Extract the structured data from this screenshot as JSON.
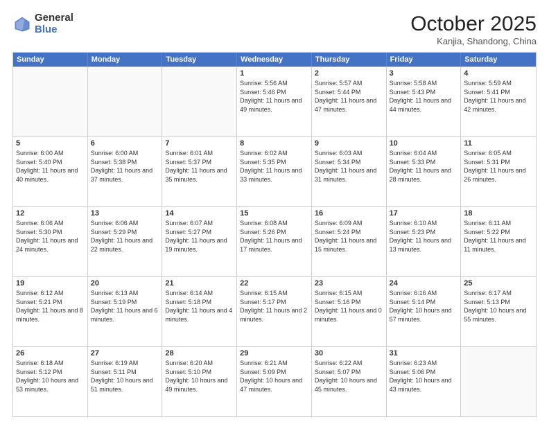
{
  "header": {
    "logo_general": "General",
    "logo_blue": "Blue",
    "title": "October 2025",
    "location": "Kanjia, Shandong, China"
  },
  "weekdays": [
    "Sunday",
    "Monday",
    "Tuesday",
    "Wednesday",
    "Thursday",
    "Friday",
    "Saturday"
  ],
  "rows": [
    [
      {
        "day": "",
        "text": ""
      },
      {
        "day": "",
        "text": ""
      },
      {
        "day": "",
        "text": ""
      },
      {
        "day": "1",
        "text": "Sunrise: 5:56 AM\nSunset: 5:46 PM\nDaylight: 11 hours and 49 minutes."
      },
      {
        "day": "2",
        "text": "Sunrise: 5:57 AM\nSunset: 5:44 PM\nDaylight: 11 hours and 47 minutes."
      },
      {
        "day": "3",
        "text": "Sunrise: 5:58 AM\nSunset: 5:43 PM\nDaylight: 11 hours and 44 minutes."
      },
      {
        "day": "4",
        "text": "Sunrise: 5:59 AM\nSunset: 5:41 PM\nDaylight: 11 hours and 42 minutes."
      }
    ],
    [
      {
        "day": "5",
        "text": "Sunrise: 6:00 AM\nSunset: 5:40 PM\nDaylight: 11 hours and 40 minutes."
      },
      {
        "day": "6",
        "text": "Sunrise: 6:00 AM\nSunset: 5:38 PM\nDaylight: 11 hours and 37 minutes."
      },
      {
        "day": "7",
        "text": "Sunrise: 6:01 AM\nSunset: 5:37 PM\nDaylight: 11 hours and 35 minutes."
      },
      {
        "day": "8",
        "text": "Sunrise: 6:02 AM\nSunset: 5:35 PM\nDaylight: 11 hours and 33 minutes."
      },
      {
        "day": "9",
        "text": "Sunrise: 6:03 AM\nSunset: 5:34 PM\nDaylight: 11 hours and 31 minutes."
      },
      {
        "day": "10",
        "text": "Sunrise: 6:04 AM\nSunset: 5:33 PM\nDaylight: 11 hours and 28 minutes."
      },
      {
        "day": "11",
        "text": "Sunrise: 6:05 AM\nSunset: 5:31 PM\nDaylight: 11 hours and 26 minutes."
      }
    ],
    [
      {
        "day": "12",
        "text": "Sunrise: 6:06 AM\nSunset: 5:30 PM\nDaylight: 11 hours and 24 minutes."
      },
      {
        "day": "13",
        "text": "Sunrise: 6:06 AM\nSunset: 5:29 PM\nDaylight: 11 hours and 22 minutes."
      },
      {
        "day": "14",
        "text": "Sunrise: 6:07 AM\nSunset: 5:27 PM\nDaylight: 11 hours and 19 minutes."
      },
      {
        "day": "15",
        "text": "Sunrise: 6:08 AM\nSunset: 5:26 PM\nDaylight: 11 hours and 17 minutes."
      },
      {
        "day": "16",
        "text": "Sunrise: 6:09 AM\nSunset: 5:24 PM\nDaylight: 11 hours and 15 minutes."
      },
      {
        "day": "17",
        "text": "Sunrise: 6:10 AM\nSunset: 5:23 PM\nDaylight: 11 hours and 13 minutes."
      },
      {
        "day": "18",
        "text": "Sunrise: 6:11 AM\nSunset: 5:22 PM\nDaylight: 11 hours and 11 minutes."
      }
    ],
    [
      {
        "day": "19",
        "text": "Sunrise: 6:12 AM\nSunset: 5:21 PM\nDaylight: 11 hours and 8 minutes."
      },
      {
        "day": "20",
        "text": "Sunrise: 6:13 AM\nSunset: 5:19 PM\nDaylight: 11 hours and 6 minutes."
      },
      {
        "day": "21",
        "text": "Sunrise: 6:14 AM\nSunset: 5:18 PM\nDaylight: 11 hours and 4 minutes."
      },
      {
        "day": "22",
        "text": "Sunrise: 6:15 AM\nSunset: 5:17 PM\nDaylight: 11 hours and 2 minutes."
      },
      {
        "day": "23",
        "text": "Sunrise: 6:15 AM\nSunset: 5:16 PM\nDaylight: 11 hours and 0 minutes."
      },
      {
        "day": "24",
        "text": "Sunrise: 6:16 AM\nSunset: 5:14 PM\nDaylight: 10 hours and 57 minutes."
      },
      {
        "day": "25",
        "text": "Sunrise: 6:17 AM\nSunset: 5:13 PM\nDaylight: 10 hours and 55 minutes."
      }
    ],
    [
      {
        "day": "26",
        "text": "Sunrise: 6:18 AM\nSunset: 5:12 PM\nDaylight: 10 hours and 53 minutes."
      },
      {
        "day": "27",
        "text": "Sunrise: 6:19 AM\nSunset: 5:11 PM\nDaylight: 10 hours and 51 minutes."
      },
      {
        "day": "28",
        "text": "Sunrise: 6:20 AM\nSunset: 5:10 PM\nDaylight: 10 hours and 49 minutes."
      },
      {
        "day": "29",
        "text": "Sunrise: 6:21 AM\nSunset: 5:09 PM\nDaylight: 10 hours and 47 minutes."
      },
      {
        "day": "30",
        "text": "Sunrise: 6:22 AM\nSunset: 5:07 PM\nDaylight: 10 hours and 45 minutes."
      },
      {
        "day": "31",
        "text": "Sunrise: 6:23 AM\nSunset: 5:06 PM\nDaylight: 10 hours and 43 minutes."
      },
      {
        "day": "",
        "text": ""
      }
    ]
  ]
}
